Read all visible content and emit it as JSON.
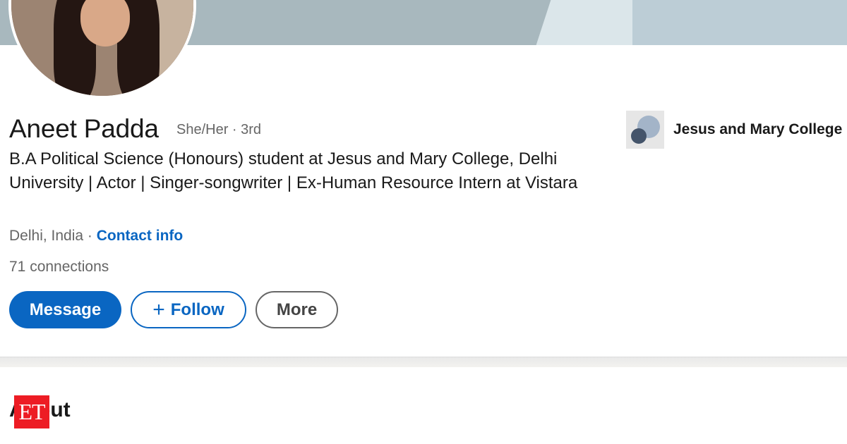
{
  "profile": {
    "name": "Aneet Padda",
    "pronouns_degree": "She/Her · 3rd",
    "headline": "B.A Political Science (Honours) student at Jesus and Mary College, Delhi University | Actor | Singer-songwriter | Ex-Human Resource Intern at Vistara",
    "location": "Delhi, India",
    "location_separator": " · ",
    "contact_info": "Contact info",
    "connections": "71 connections"
  },
  "actions": {
    "message": "Message",
    "follow_icon": "+",
    "follow": "Follow",
    "more": "More"
  },
  "education": {
    "name": "Jesus and Mary College",
    "logo_icon": "college-logo-icon"
  },
  "about": {
    "title": "About"
  },
  "watermark": {
    "text": "ET"
  },
  "colors": {
    "accent": "#0a66c2",
    "watermark": "#ed1c24"
  }
}
